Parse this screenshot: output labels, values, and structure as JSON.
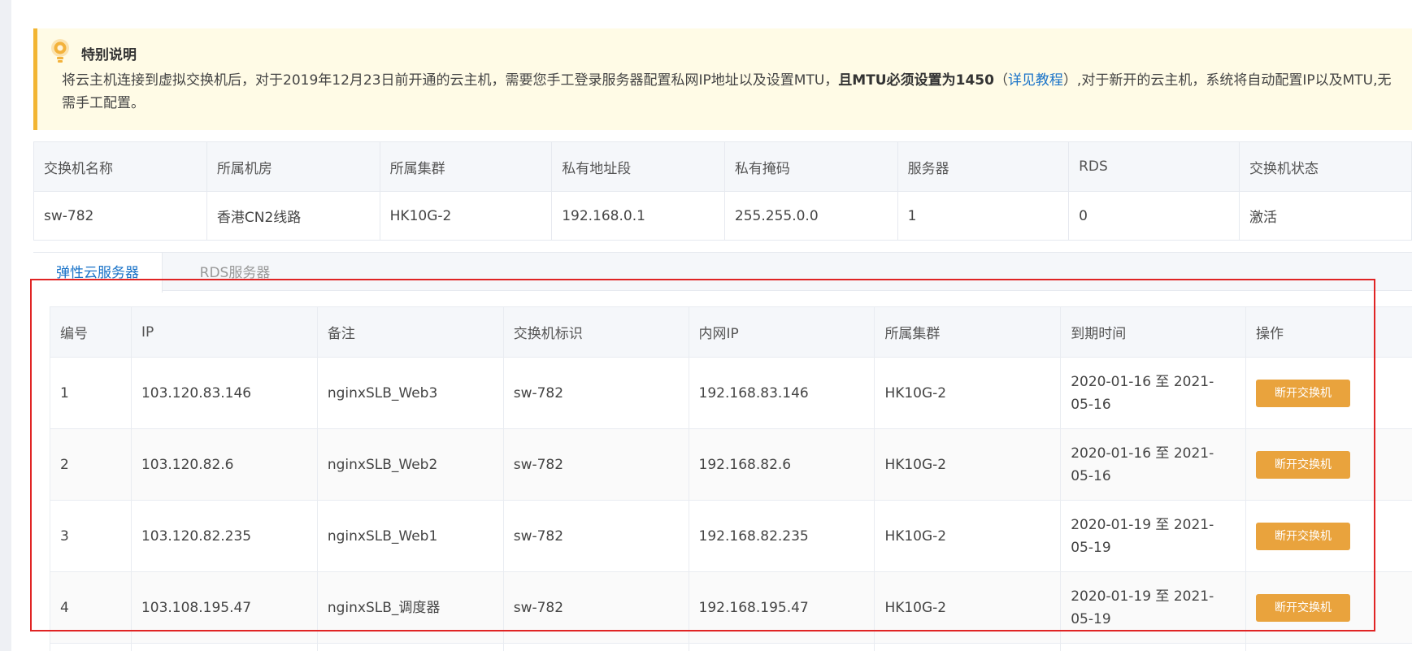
{
  "colors": {
    "accent": "#1a73c8",
    "button": "#e9a33d",
    "notice_bg": "#fffbe6",
    "notice_border": "#f2b532",
    "highlight": "#e02424"
  },
  "notice": {
    "icon": "lightbulb-icon",
    "title": "特别说明",
    "text_1": "将云主机连接到虚拟交换机后，对于2019年12月23日前开通的云主机，需要您手工登录服务器配置私网IP地址以及设置MTU，",
    "bold": "且MTU必须设置为1450",
    "paren_open": "（",
    "link": "详见教程",
    "text_2": "）,对于新开的云主机，系统将自动配置IP以及MTU,无",
    "text_3": "需手工配置。"
  },
  "switch_info": {
    "headers": [
      "交换机名称",
      "所属机房",
      "所属集群",
      "私有地址段",
      "私有掩码",
      "服务器",
      "RDS",
      "交换机状态"
    ],
    "row": [
      "sw-782",
      "香港CN2线路",
      "HK10G-2",
      "192.168.0.1",
      "255.255.0.0",
      "1",
      "0",
      "激活"
    ]
  },
  "tabs": [
    {
      "label": "弹性云服务器",
      "active": true
    },
    {
      "label": "RDS服务器",
      "active": false
    }
  ],
  "servers": {
    "headers": [
      "编号",
      "IP",
      "备注",
      "交换机标识",
      "内网IP",
      "所属集群",
      "到期时间",
      "操作"
    ],
    "rows": [
      {
        "id": "1",
        "ip": "103.120.83.146",
        "note": "nginxSLB_Web3",
        "switch": "sw-782",
        "inner_ip": "192.168.83.146",
        "cluster": "HK10G-2",
        "expire": "2020-01-16 至 2021-05-16",
        "action": "断开交换机"
      },
      {
        "id": "2",
        "ip": "103.120.82.6",
        "note": "nginxSLB_Web2",
        "switch": "sw-782",
        "inner_ip": "192.168.82.6",
        "cluster": "HK10G-2",
        "expire": "2020-01-16 至 2021-05-16",
        "action": "断开交换机"
      },
      {
        "id": "3",
        "ip": "103.120.82.235",
        "note": "nginxSLB_Web1",
        "switch": "sw-782",
        "inner_ip": "192.168.82.235",
        "cluster": "HK10G-2",
        "expire": "2020-01-19 至 2021-05-19",
        "action": "断开交换机"
      },
      {
        "id": "4",
        "ip": "103.108.195.47",
        "note": "nginxSLB_调度器",
        "switch": "sw-782",
        "inner_ip": "192.168.195.47",
        "cluster": "HK10G-2",
        "expire": "2020-01-19 至 2021-05-19",
        "action": "断开交换机"
      }
    ]
  }
}
